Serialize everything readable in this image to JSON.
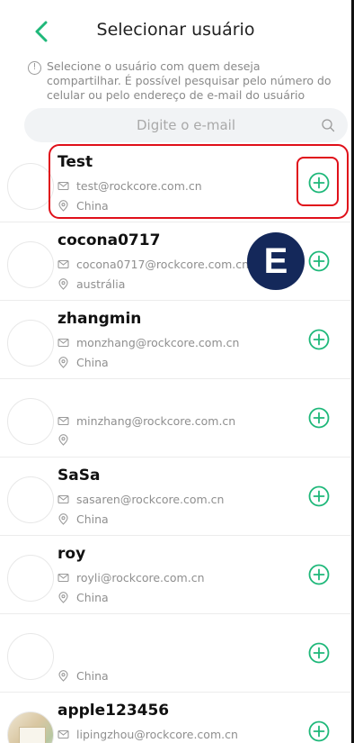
{
  "header": {
    "title": "Selecionar usuário"
  },
  "notice": {
    "text": "Selecione o usuário com quem deseja compartilhar. É possível pesquisar pelo número do celular ou pelo endereço de e-mail do usuário"
  },
  "search": {
    "placeholder": "Digite o e-mail",
    "value": ""
  },
  "colors": {
    "accent": "#1fb87a",
    "highlight": "#e0101a",
    "badge": "#14285a"
  },
  "badge": {
    "label": "E"
  },
  "users": [
    {
      "name": "Test",
      "email": "test@rockcore.com.cn",
      "country": "China"
    },
    {
      "name": "cocona0717",
      "email": "cocona0717@rockcore.com.cn",
      "country": "austrália"
    },
    {
      "name": "zhangmin",
      "email": "monzhang@rockcore.com.cn",
      "country": "China"
    },
    {
      "name": "",
      "email": "minzhang@rockcore.com.cn",
      "country": ""
    },
    {
      "name": "SaSa",
      "email": "sasaren@rockcore.com.cn",
      "country": "China"
    },
    {
      "name": "roy",
      "email": "royli@rockcore.com.cn",
      "country": "China"
    },
    {
      "name": "",
      "email": "",
      "country": "China"
    },
    {
      "name": "apple123456",
      "email": "lipingzhou@rockcore.com.cn",
      "country": ""
    }
  ],
  "icons": {
    "back": "chevron-left-icon",
    "info": "info-icon",
    "search": "search-icon",
    "email": "mail-icon",
    "location": "location-pin-icon",
    "add": "plus-circle-icon"
  }
}
